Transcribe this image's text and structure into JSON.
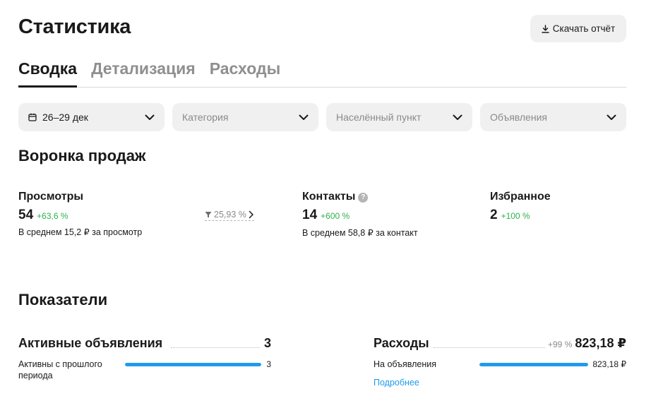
{
  "header": {
    "title": "Статистика",
    "download_label": "Скачать отчёт"
  },
  "tabs": [
    {
      "label": "Сводка",
      "active": true
    },
    {
      "label": "Детализация",
      "active": false
    },
    {
      "label": "Расходы",
      "active": false
    }
  ],
  "filters": {
    "date": "26–29 дек",
    "category": "Категория",
    "city": "Населённый пункт",
    "listings": "Объявления"
  },
  "funnel": {
    "title": "Воронка продаж",
    "views": {
      "label": "Просмотры",
      "value": "54",
      "delta": "+63,6 %",
      "sub": "В среднем 15,2 ₽ за просмотр"
    },
    "conversion": "25,93 %",
    "contacts": {
      "label": "Контакты",
      "info": "?",
      "value": "14",
      "delta": "+600 %",
      "sub": "В среднем 58,8 ₽ за контакт"
    },
    "favorites": {
      "label": "Избранное",
      "value": "2",
      "delta": "+100 %"
    }
  },
  "indicators": {
    "title": "Показатели",
    "active": {
      "label": "Активные объявления",
      "value": "3",
      "sub_label": "Активны с прошлого периода",
      "bar_value": "3",
      "fill": 1.0
    },
    "expenses": {
      "label": "Расходы",
      "prefix": "+99 %",
      "value": "823,18 ₽",
      "sub_label": "На объявления",
      "bar_value": "823,18 ₽",
      "fill": 1.0,
      "link": "Подробнее"
    }
  },
  "colors": {
    "accent": "#1e9bea",
    "positive": "#2bb24c",
    "muted": "#8a8a8a",
    "chip_bg": "#f0f0f0"
  }
}
